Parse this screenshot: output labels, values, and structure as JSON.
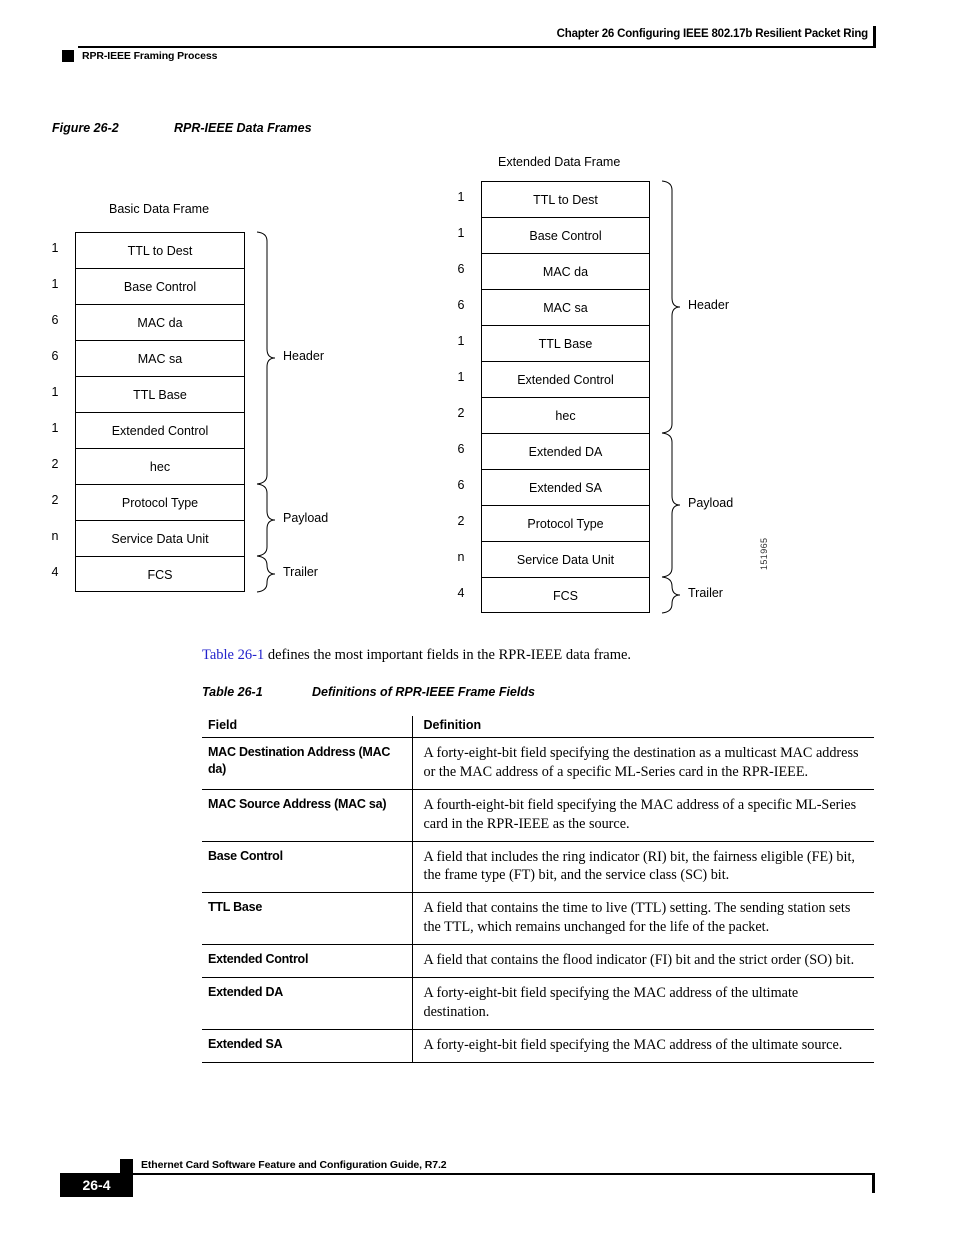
{
  "header": {
    "chapter": "Chapter 26  Configuring IEEE 802.17b Resilient Packet Ring",
    "section": "RPR-IEEE Framing Process"
  },
  "figure": {
    "caption_number": "Figure 26-2",
    "caption_title": "RPR-IEEE Data Frames",
    "figure_id": "151965",
    "basic_frame": {
      "title": "Basic Data Frame",
      "rows": [
        {
          "size": "1",
          "label": "TTL to Dest"
        },
        {
          "size": "1",
          "label": "Base Control"
        },
        {
          "size": "6",
          "label": "MAC da"
        },
        {
          "size": "6",
          "label": "MAC sa"
        },
        {
          "size": "1",
          "label": "TTL Base"
        },
        {
          "size": "1",
          "label": "Extended Control"
        },
        {
          "size": "2",
          "label": "hec"
        },
        {
          "size": "2",
          "label": "Protocol Type"
        },
        {
          "size": "n",
          "label": "Service Data Unit"
        },
        {
          "size": "4",
          "label": "FCS"
        }
      ],
      "groups": [
        {
          "label": "Header",
          "first_row": 0,
          "last_row": 6
        },
        {
          "label": "Payload",
          "first_row": 7,
          "last_row": 8
        },
        {
          "label": "Trailer",
          "first_row": 9,
          "last_row": 9
        }
      ]
    },
    "extended_frame": {
      "title": "Extended Data Frame",
      "rows": [
        {
          "size": "1",
          "label": "TTL to Dest"
        },
        {
          "size": "1",
          "label": "Base Control"
        },
        {
          "size": "6",
          "label": "MAC da"
        },
        {
          "size": "6",
          "label": "MAC sa"
        },
        {
          "size": "1",
          "label": "TTL Base"
        },
        {
          "size": "1",
          "label": "Extended Control"
        },
        {
          "size": "2",
          "label": "hec"
        },
        {
          "size": "6",
          "label": "Extended DA"
        },
        {
          "size": "6",
          "label": "Extended SA"
        },
        {
          "size": "2",
          "label": "Protocol Type"
        },
        {
          "size": "n",
          "label": "Service Data Unit"
        },
        {
          "size": "4",
          "label": "FCS"
        }
      ],
      "groups": [
        {
          "label": "Header",
          "first_row": 0,
          "last_row": 6
        },
        {
          "label": "Payload",
          "first_row": 7,
          "last_row": 10
        },
        {
          "label": "Trailer",
          "first_row": 11,
          "last_row": 11
        }
      ]
    }
  },
  "intro": {
    "xref": "Table 26-1",
    "rest": " defines the most important fields in the RPR-IEEE data frame."
  },
  "table": {
    "caption_number": "Table 26-1",
    "caption_title": "Definitions of RPR-IEEE Frame Fields",
    "columns": [
      "Field",
      "Definition"
    ],
    "rows": [
      {
        "field": "MAC Destination Address (MAC da)",
        "definition": "A forty-eight-bit field specifying the destination as a multicast MAC address or the MAC address of a specific ML-Series card in the RPR-IEEE."
      },
      {
        "field": "MAC Source Address (MAC sa)",
        "definition": "A fourth-eight-bit field specifying the MAC address of a specific ML-Series card in the RPR-IEEE as the source."
      },
      {
        "field": "Base Control",
        "definition": "A field that includes the ring indicator (RI) bit, the fairness eligible (FE) bit, the frame type (FT) bit, and the service class (SC) bit."
      },
      {
        "field": "TTL Base",
        "definition": "A field that contains the time to live (TTL) setting. The sending station sets the TTL, which remains unchanged for the life of the packet."
      },
      {
        "field": "Extended Control",
        "definition": "A field that contains the flood indicator (FI) bit and the strict order (SO) bit."
      },
      {
        "field": "Extended DA",
        "definition": "A forty-eight-bit field specifying the MAC address of the ultimate destination."
      },
      {
        "field": "Extended SA",
        "definition": "A forty-eight-bit field specifying the MAC address of the ultimate source."
      }
    ]
  },
  "footer": {
    "guide": "Ethernet Card Software Feature and Configuration Guide, R7.2",
    "page_number": "26-4"
  }
}
